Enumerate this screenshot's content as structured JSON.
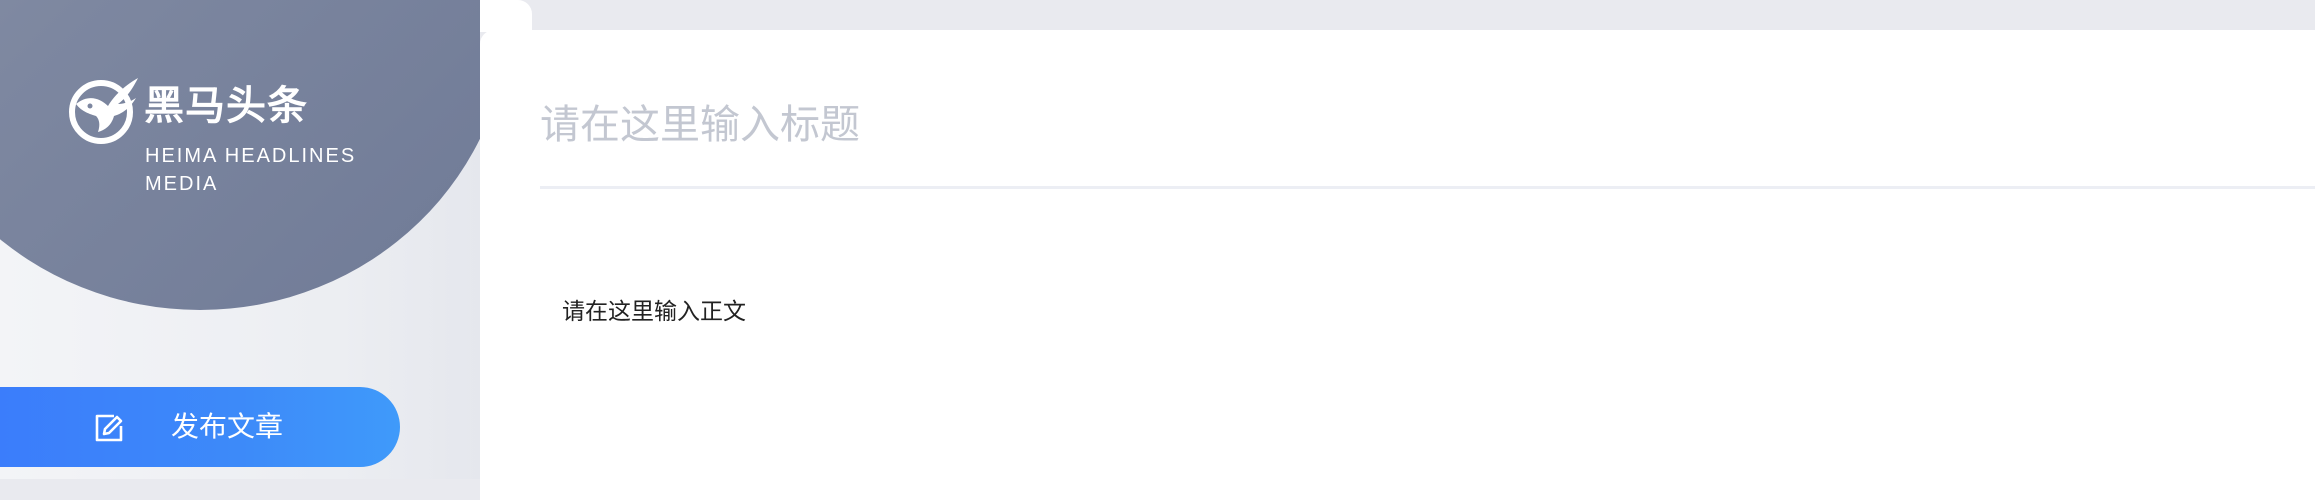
{
  "brand": {
    "logo_icon": "pegasus-logo-icon",
    "name_cn": "黑马头条",
    "name_en": "HEIMA HEADLINES MEDIA",
    "circle_color": "#7d87a0"
  },
  "sidebar": {
    "items": [
      {
        "label": "发布文章",
        "icon": "edit-icon",
        "active": true,
        "color": "#3b82fa"
      }
    ]
  },
  "editor": {
    "title_placeholder": "请在这里输入标题",
    "title_value": "",
    "content_placeholder": "请在这里输入正文",
    "content_value": ""
  }
}
